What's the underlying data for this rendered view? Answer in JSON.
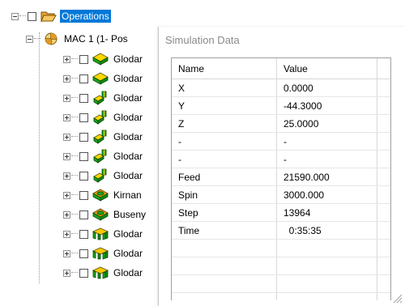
{
  "tree": {
    "root": {
      "label": "Operations"
    },
    "machine": {
      "label": "MAC 1 (1- Pos"
    },
    "operations": [
      {
        "label": "Glodar",
        "icon": "face-mill-icon"
      },
      {
        "label": "Glodar",
        "icon": "face-mill-icon"
      },
      {
        "label": "Glodar",
        "icon": "contour-mill-icon"
      },
      {
        "label": "Glodar",
        "icon": "contour-mill-icon"
      },
      {
        "label": "Glodar",
        "icon": "contour-mill-icon"
      },
      {
        "label": "Glodar",
        "icon": "contour-mill-icon"
      },
      {
        "label": "Glodar",
        "icon": "contour-mill-icon"
      },
      {
        "label": "Kirnan",
        "icon": "hole-drill-icon"
      },
      {
        "label": "Buseny",
        "icon": "hole-drill-icon"
      },
      {
        "label": "Glodar",
        "icon": "pocket-mill-icon"
      },
      {
        "label": "Glodar",
        "icon": "pocket-mill-icon"
      },
      {
        "label": "Glodar",
        "icon": "pocket-mill-icon"
      }
    ]
  },
  "simulation": {
    "title": "Simulation Data",
    "columns": {
      "name": "Name",
      "value": "Value"
    },
    "rows": [
      {
        "name": "X",
        "value": "0.0000"
      },
      {
        "name": "Y",
        "value": "-44.3000"
      },
      {
        "name": "Z",
        "value": "25.0000"
      },
      {
        "name": "-",
        "value": "-"
      },
      {
        "name": "-",
        "value": "-"
      },
      {
        "name": "Feed",
        "value": "21590.000"
      },
      {
        "name": "Spin",
        "value": "3000.000"
      },
      {
        "name": "Step",
        "value": "13964"
      },
      {
        "name": "Time",
        "value": "  0:35:35"
      }
    ]
  },
  "colors": {
    "selection": "#0078d7",
    "folder": "#f2b84b",
    "face_mill_top": "#ffd800",
    "face_mill_side": "#1aa31a",
    "drill": "#f0a000",
    "pocket_mill": "#f5c800"
  }
}
